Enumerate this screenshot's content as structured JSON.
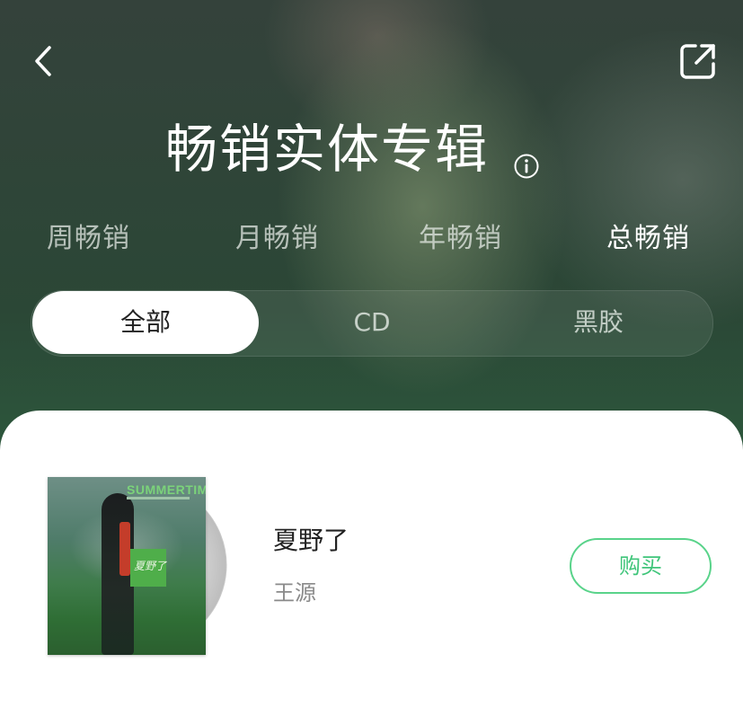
{
  "header": {
    "back_icon": "chevron-left-icon",
    "share_icon": "share-external-icon",
    "title": "畅销实体专辑",
    "info_icon": "info-circle-icon"
  },
  "period_tabs": [
    {
      "label": "周畅销",
      "active": false
    },
    {
      "label": "月畅销",
      "active": false
    },
    {
      "label": "年畅销",
      "active": false
    },
    {
      "label": "总畅销",
      "active": true
    }
  ],
  "format_filter": [
    {
      "label": "全部",
      "active": true
    },
    {
      "label": "CD",
      "active": false
    },
    {
      "label": "黑胶",
      "active": false
    }
  ],
  "albums": [
    {
      "cover_text": "SUMMERTIME",
      "badge_text": "夏野了",
      "title": "夏野了",
      "artist": "王源",
      "buy_label": "购买"
    }
  ],
  "colors": {
    "accent_green": "#3fc57a",
    "buy_border": "#59d38a",
    "text_primary": "#222222",
    "text_secondary": "#8a8a8a"
  }
}
